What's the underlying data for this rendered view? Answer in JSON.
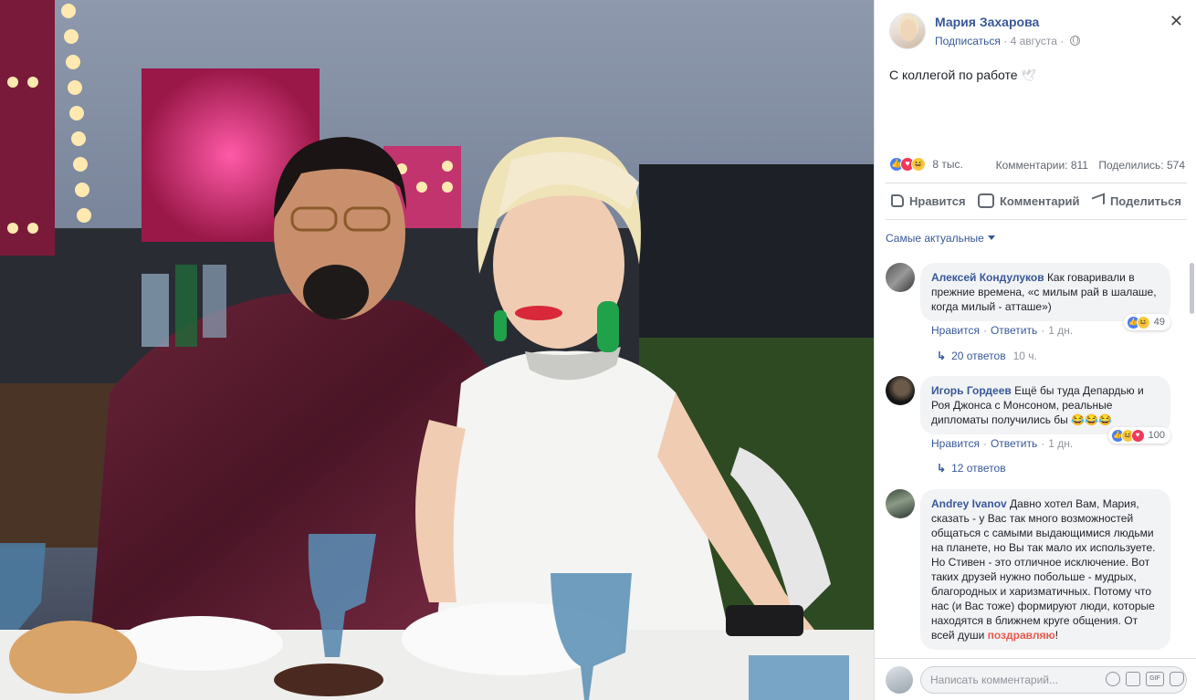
{
  "post": {
    "author": "Мария Захарова",
    "subscribe": "Подписаться",
    "date": "4 августа",
    "text": "С коллегой по работе",
    "emoji": "🕊"
  },
  "reactions": {
    "count": "8 тыс.",
    "comments": "Комментарии: 811",
    "shares": "Поделились: 574"
  },
  "actions": {
    "like": "Нравится",
    "comment": "Комментарий",
    "share": "Поделиться"
  },
  "sort_label": "Самые актуальные",
  "comments": [
    {
      "author": "Алексей Кондулуков",
      "text": "Как говаривали в прежние времена, «с милым рай в шалаше, когда милый - атташе»)",
      "like": "Нравится",
      "reply": "Ответить",
      "time": "1 дн.",
      "reactions": "49",
      "replies": "20 ответов",
      "replies_time": "10 ч."
    },
    {
      "author": "Игорь Гордеев",
      "text": "Ещё бы туда Депардью и Роя Джонса с Монсоном, реальные дипломаты получились бы",
      "emoji": "😂😂😂",
      "like": "Нравится",
      "reply": "Ответить",
      "time": "1 дн.",
      "reactions": "100",
      "replies": "12 ответов"
    },
    {
      "author": "Andrey Ivanov",
      "text": "Давно хотел Вам, Мария, сказать - у Вас так много возможностей общаться с самыми выдающимися людьми на планете, но Вы так мало их используете. Но Стивен - это отличное исключение. Вот таких друзей нужно побольше - мудрых, благородных и харизматичных. Потому что нас (и Вас тоже) формируют люди, которые находятся в ближнем круге общения. От всей души",
      "highlight": "поздравляю",
      "tail": "!"
    }
  ],
  "write": {
    "placeholder": "Написать комментарий..."
  },
  "colors": {
    "link": "#385898",
    "like": "#4a7ff3",
    "love": "#f0385a",
    "haha": "#f7c948"
  }
}
